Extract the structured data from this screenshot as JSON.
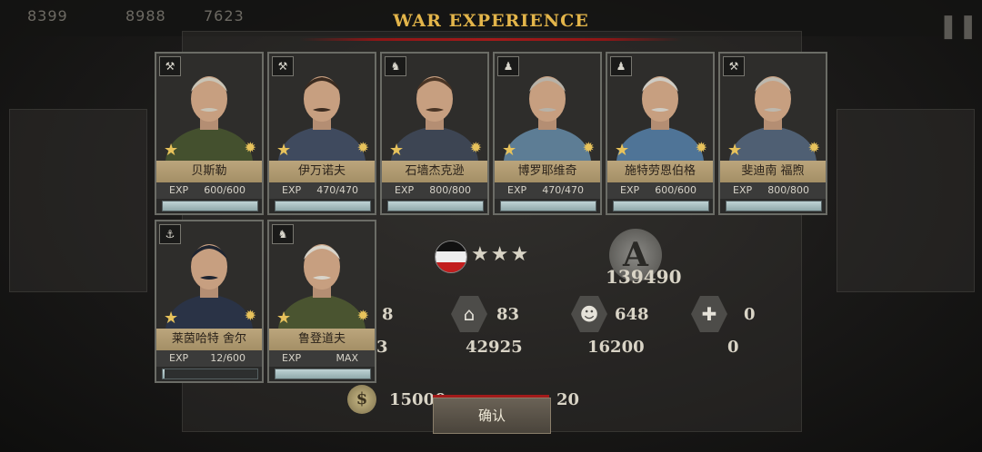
{
  "resources": [
    "8399",
    "8988",
    "7623"
  ],
  "title": "WAR EXPERIENCE",
  "generals": [
    {
      "name": "贝斯勒",
      "exp_label": "EXP",
      "exp": "600/600",
      "fill": 1.0,
      "type_icon": "artillery-icon",
      "uniform": "#44502e",
      "hair": "#c9c4b6"
    },
    {
      "name": "伊万诺夫",
      "exp_label": "EXP",
      "exp": "470/470",
      "fill": 1.0,
      "type_icon": "artillery-icon",
      "uniform": "#3f4a5e",
      "hair": "#3b2b20"
    },
    {
      "name": "石墙杰克逊",
      "exp_label": "EXP",
      "exp": "800/800",
      "fill": 1.0,
      "type_icon": "cavalry-icon",
      "uniform": "#3d4553",
      "hair": "#4a3525"
    },
    {
      "name": "博罗耶维奇",
      "exp_label": "EXP",
      "exp": "470/470",
      "fill": 1.0,
      "type_icon": "infantry-icon",
      "uniform": "#5d7d95",
      "hair": "#b7b2a8"
    },
    {
      "name": "施特劳恩伯格",
      "exp_label": "EXP",
      "exp": "600/600",
      "fill": 1.0,
      "type_icon": "infantry-icon",
      "uniform": "#4f7497",
      "hair": "#cfccc4"
    },
    {
      "name": "斐迪南 福煦",
      "exp_label": "EXP",
      "exp": "800/800",
      "fill": 1.0,
      "type_icon": "artillery-icon",
      "uniform": "#4f5f73",
      "hair": "#bdb8ae"
    },
    {
      "name": "莱茵哈特 舍尔",
      "exp_label": "EXP",
      "exp": "12/600",
      "fill": 0.02,
      "type_icon": "navy-icon",
      "uniform": "#2a3346",
      "hair": "#1e2430"
    },
    {
      "name": "鲁登道夫",
      "exp_label": "EXP",
      "exp": "MAX",
      "fill": 1.0,
      "type_icon": "cavalry-icon",
      "uniform": "#4a5430",
      "hair": "#d8d4ca"
    }
  ],
  "stats": {
    "left_top": "8",
    "left_bottom": "3",
    "buildings_top": "83",
    "buildings_bottom": "42925",
    "soldiers_top": "648",
    "soldiers_bottom": "16200",
    "medic_top": "0",
    "medic_bottom": "0"
  },
  "emblem_value": "139490",
  "coin_value": "15000",
  "medal_value": "20",
  "confirm_label": "确认"
}
